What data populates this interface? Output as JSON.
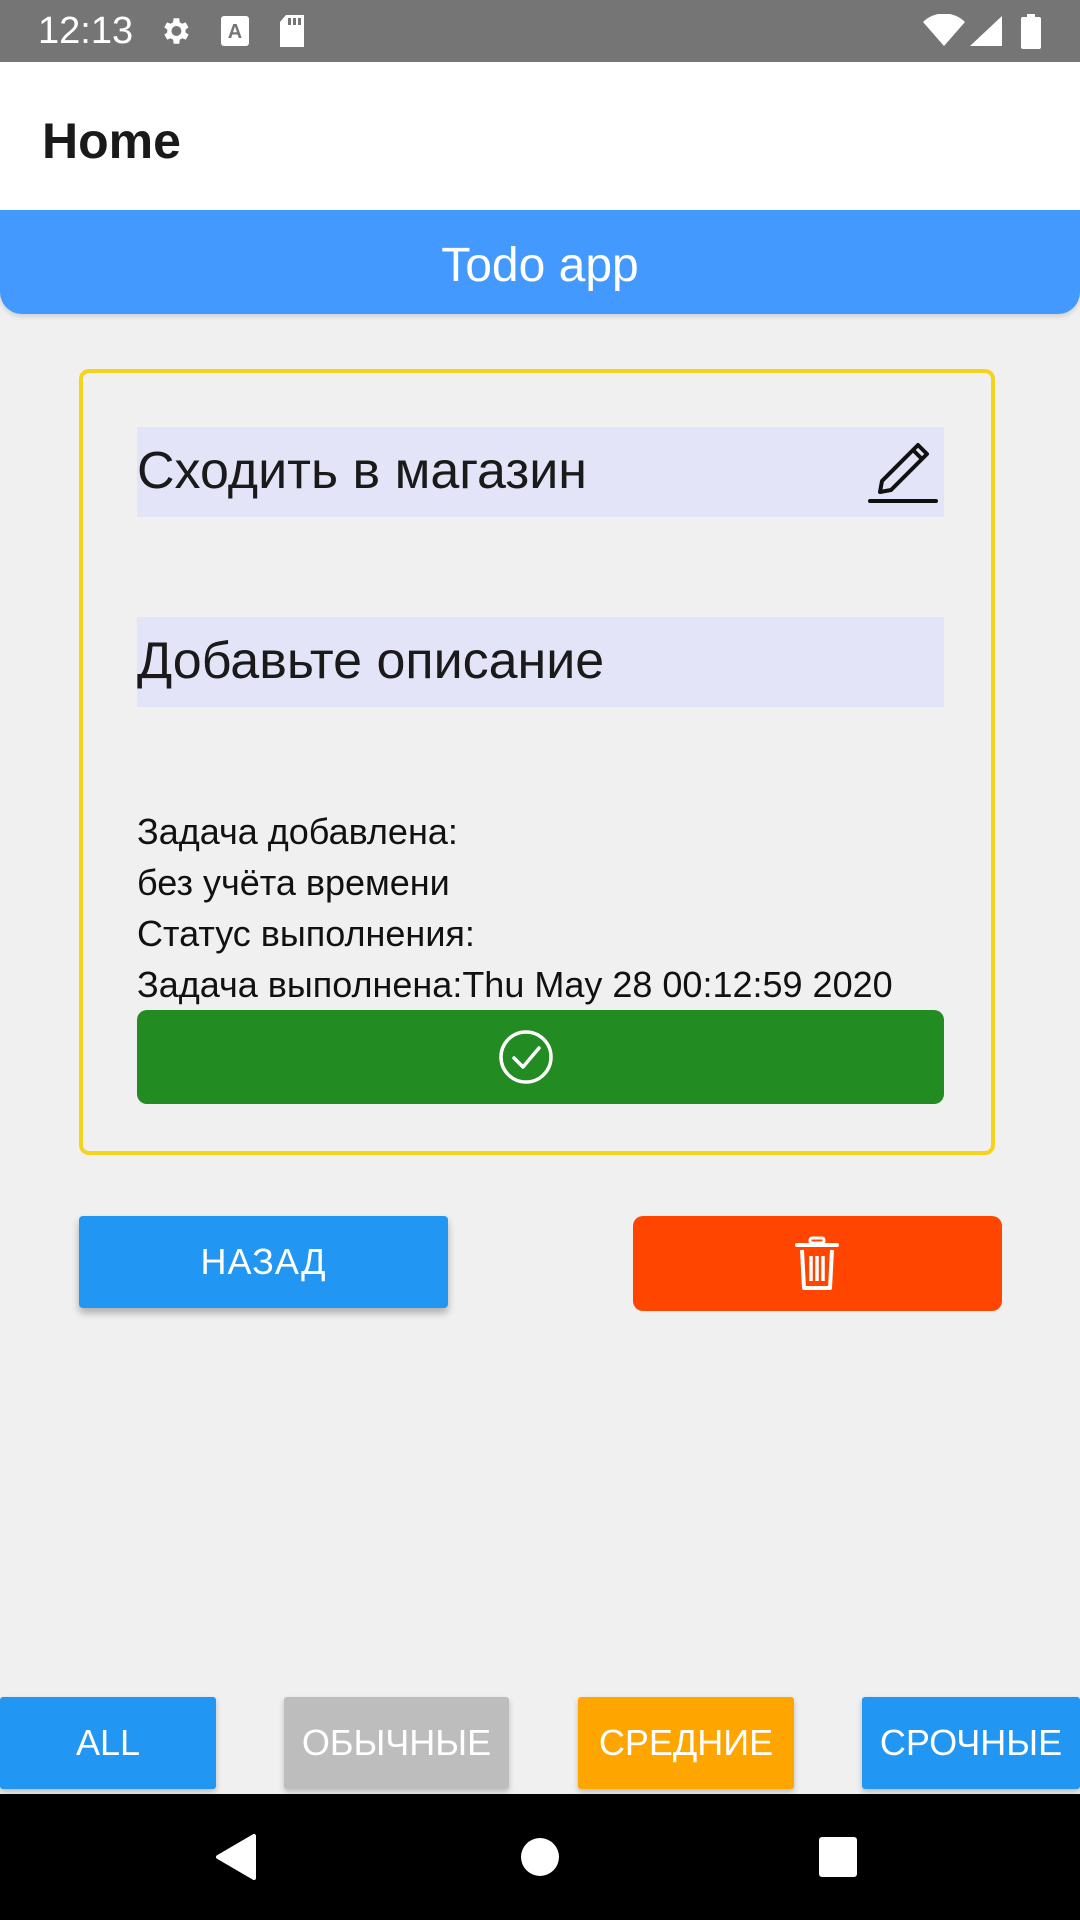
{
  "status_bar": {
    "time": "12:13",
    "icons": [
      "gear-icon",
      "text-a-icon",
      "sd-card-icon",
      "wifi-icon",
      "cellular-signal-icon",
      "battery-icon"
    ]
  },
  "app_bar": {
    "title": "Home"
  },
  "header": {
    "title": "Todo app"
  },
  "task": {
    "title": "Сходить в магазин",
    "description_placeholder": "Добавьте описание",
    "added_line": "Задача добавлена:",
    "added_time": "без учёта времени",
    "status_line": "Статус выполнения:",
    "completed_line": "Задача выполнена:Thu May 28 00:12:59 2020",
    "complete_icon": "check-circle-icon",
    "edit_icon": "pencil-icon"
  },
  "actions": {
    "back_label": "НАЗАД",
    "delete_icon": "trash-icon"
  },
  "filters": [
    {
      "label": "ALL"
    },
    {
      "label": "ОБЫЧНЫЕ"
    },
    {
      "label": "СРЕДНИЕ"
    },
    {
      "label": "СРОЧНЫЕ"
    }
  ],
  "colors": {
    "status_bar": "#757575",
    "header": "#4499ff",
    "card_border": "#f5d31a",
    "field_bg": "#e4e4f8",
    "complete_button": "#228b22",
    "back_button": "#2196f3",
    "delete_button": "#ff4500",
    "filter_all": "#2196f3",
    "filter_normal": "#bdbdbd",
    "filter_medium": "#ffa500",
    "filter_urgent": "#2196f3"
  },
  "nav_bar": {
    "icons": [
      "back-triangle-icon",
      "home-circle-icon",
      "recents-square-icon"
    ]
  }
}
